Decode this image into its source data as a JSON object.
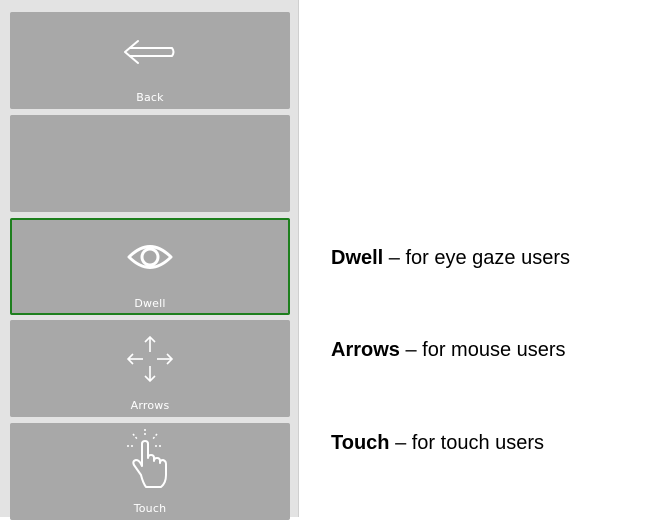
{
  "menu": {
    "tiles": [
      {
        "label": "Back",
        "icon": "back-arrow-icon"
      },
      {
        "label": "",
        "icon": ""
      },
      {
        "label": "Dwell",
        "icon": "eye-icon",
        "selected": true
      },
      {
        "label": "Arrows",
        "icon": "move-arrows-icon"
      },
      {
        "label": "Touch",
        "icon": "touch-hand-icon"
      }
    ]
  },
  "descriptions": [
    {
      "term": "Dwell",
      "text": " – for eye gaze users"
    },
    {
      "term": "Arrows",
      "text": " – for mouse users"
    },
    {
      "term": "Touch",
      "text": " – for touch users"
    }
  ],
  "colors": {
    "tile_bg": "#a8a8a8",
    "panel_bg": "#e3e3e3",
    "selected_border": "#1e7f1e",
    "label": "#ffffff"
  }
}
